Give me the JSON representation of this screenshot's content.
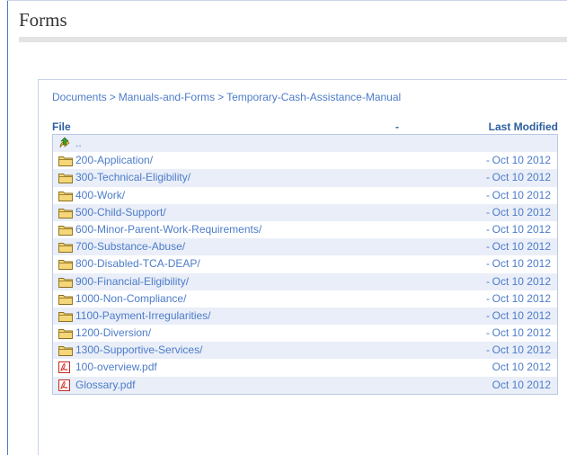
{
  "page": {
    "title": "Forms"
  },
  "breadcrumb": {
    "items": [
      "Documents",
      "Manuals-and-Forms",
      "Temporary-Cash-Assistance-Manual"
    ],
    "separator": ">"
  },
  "table": {
    "headers": {
      "file": "File",
      "dash": "-",
      "modified": "Last Modified"
    },
    "parent_label": "..",
    "rows": [
      {
        "icon": "folder-icon",
        "name": "200-Application/",
        "dash": "-",
        "date": "Oct 10 2012"
      },
      {
        "icon": "folder-icon",
        "name": "300-Technical-Eligibility/",
        "dash": "-",
        "date": "Oct 10 2012"
      },
      {
        "icon": "folder-icon",
        "name": "400-Work/",
        "dash": "-",
        "date": "Oct 10 2012"
      },
      {
        "icon": "folder-icon",
        "name": "500-Child-Support/",
        "dash": "-",
        "date": "Oct 10 2012"
      },
      {
        "icon": "folder-icon",
        "name": "600-Minor-Parent-Work-Requirements/",
        "dash": "-",
        "date": "Oct 10 2012"
      },
      {
        "icon": "folder-icon",
        "name": "700-Substance-Abuse/",
        "dash": "-",
        "date": "Oct 10 2012"
      },
      {
        "icon": "folder-icon",
        "name": "800-Disabled-TCA-DEAP/",
        "dash": "-",
        "date": "Oct 10 2012"
      },
      {
        "icon": "folder-icon",
        "name": "900-Financial-Eligibility/",
        "dash": "-",
        "date": "Oct 10 2012"
      },
      {
        "icon": "folder-icon",
        "name": "1000-Non-Compliance/",
        "dash": "-",
        "date": "Oct 10 2012"
      },
      {
        "icon": "folder-icon",
        "name": "1100-Payment-Irregularities/",
        "dash": "-",
        "date": "Oct 10 2012"
      },
      {
        "icon": "folder-icon",
        "name": "1200-Diversion/",
        "dash": "-",
        "date": "Oct 10 2012"
      },
      {
        "icon": "folder-icon",
        "name": "1300-Supportive-Services/",
        "dash": "-",
        "date": "Oct 10 2012"
      },
      {
        "icon": "pdf-icon",
        "name": "100-overview.pdf",
        "dash": "",
        "date": "Oct 10 2012"
      },
      {
        "icon": "pdf-icon",
        "name": "Glossary.pdf",
        "dash": "",
        "date": "Oct 10 2012"
      }
    ]
  },
  "colors": {
    "link": "#4d7cc9",
    "header": "#2c5f9e",
    "row_alt": "#e9eef8",
    "folder": "#f2c94c",
    "pdf": "#d9342b"
  }
}
